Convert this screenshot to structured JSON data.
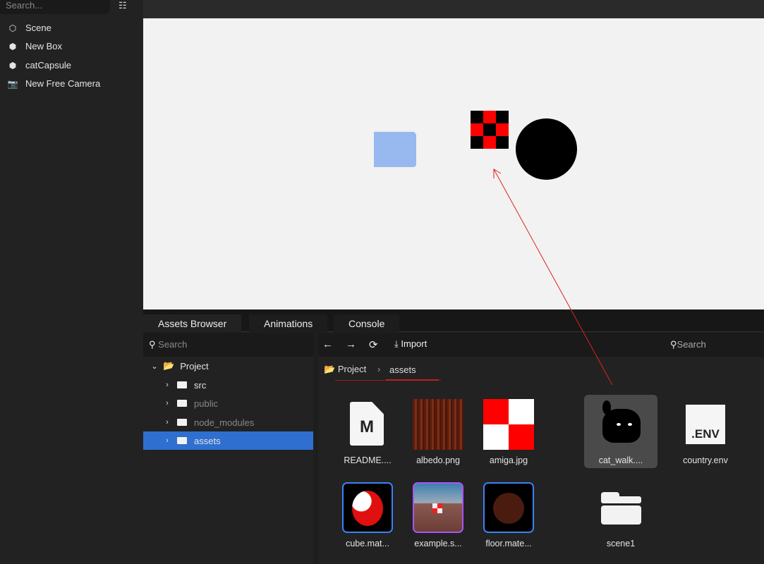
{
  "hierarchy": {
    "search_placeholder": "Search...",
    "items": [
      {
        "label": "Scene",
        "icon": "scene-icon"
      },
      {
        "label": "New Box",
        "icon": "cube-icon"
      },
      {
        "label": "catCapsule",
        "icon": "cube-icon"
      },
      {
        "label": "New Free Camera",
        "icon": "camera-icon"
      }
    ]
  },
  "panel_tabs": [
    "Assets Browser",
    "Animations",
    "Console"
  ],
  "tree": {
    "search_placeholder": "Search",
    "root": "Project",
    "children": [
      "src",
      "public",
      "node_modules",
      "assets"
    ],
    "selected": "assets"
  },
  "toolbar": {
    "import_label": "Import",
    "search_placeholder": "Search"
  },
  "breadcrumb": [
    "Project",
    "assets"
  ],
  "assets": [
    "README....",
    "albedo.png",
    "amiga.jpg",
    "cat_walk....",
    "country.env",
    "cube.mat...",
    "example.s...",
    "floor.mate...",
    "scene1"
  ],
  "env_badge": ".ENV",
  "readme_badge": "M",
  "colors": {
    "accent": "#2f6fd0",
    "annotation": "#e02020",
    "viewport_bg": "#f2f2f2"
  }
}
